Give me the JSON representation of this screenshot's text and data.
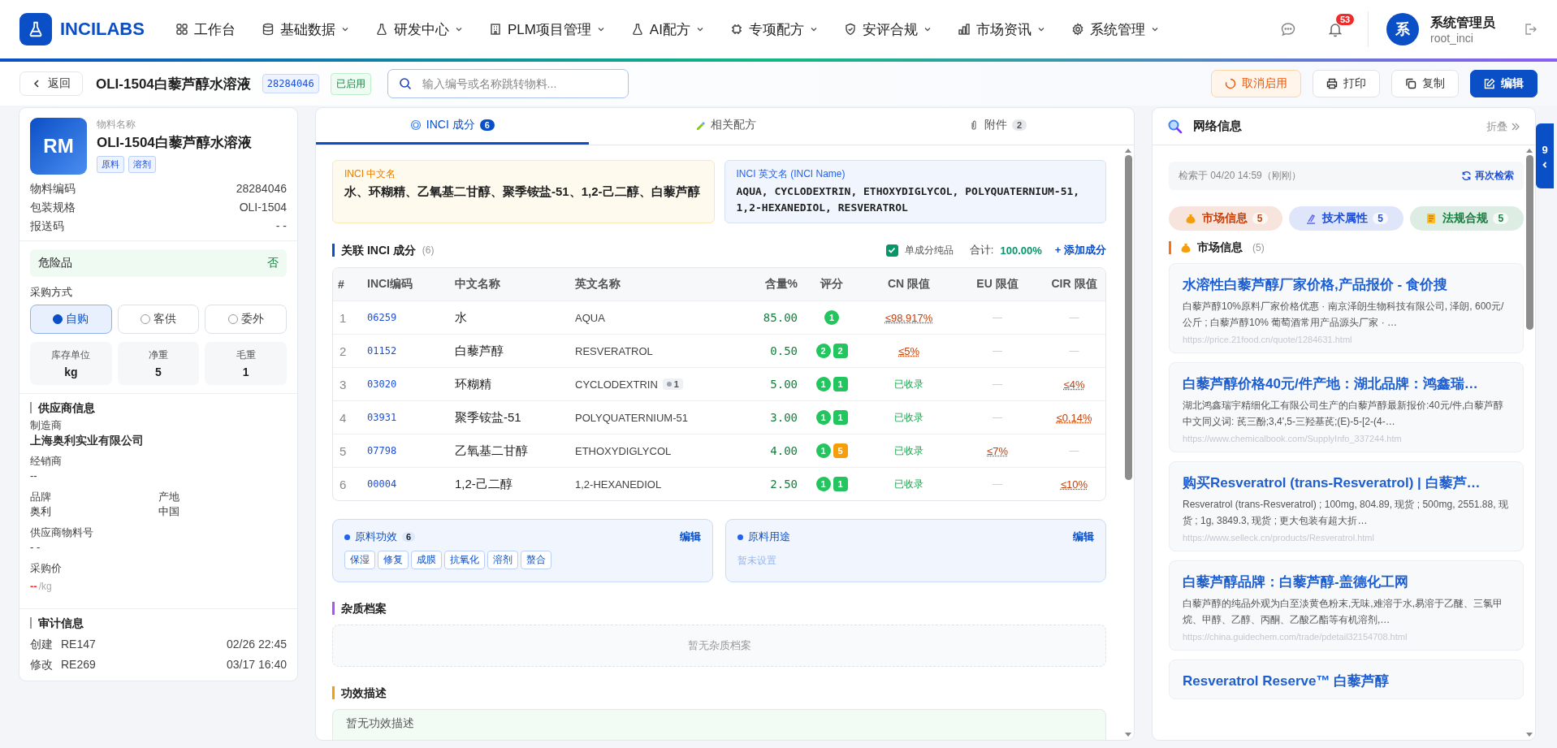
{
  "nav": {
    "logo": "INCILABS",
    "items": [
      {
        "label": "工作台",
        "dropdown": false
      },
      {
        "label": "基础数据",
        "dropdown": true
      },
      {
        "label": "研发中心",
        "dropdown": true
      },
      {
        "label": "PLM项目管理",
        "dropdown": true
      },
      {
        "label": "AI配方",
        "dropdown": true
      },
      {
        "label": "专项配方",
        "dropdown": true
      },
      {
        "label": "安评合规",
        "dropdown": true
      },
      {
        "label": "市场资讯",
        "dropdown": true
      },
      {
        "label": "系统管理",
        "dropdown": true
      }
    ],
    "notifications": "53",
    "user": {
      "avatar": "系",
      "name": "系统管理员",
      "account": "root_inci"
    }
  },
  "toolbar": {
    "back": "返回",
    "title": "OLI-1504白藜芦醇水溶液",
    "code": "28284046",
    "status": "已启用",
    "search": {
      "placeholder": "输入编号或名称跳转物料..."
    },
    "buttons": [
      {
        "label": "取消启用",
        "kind": "warning"
      },
      {
        "label": "打印",
        "kind": "default"
      },
      {
        "label": "复制",
        "kind": "default"
      },
      {
        "label": "编辑",
        "kind": "primary"
      }
    ]
  },
  "material": {
    "avatar": "RM",
    "name_label": "物料名称",
    "name": "OLI-1504白藜芦醇水溶液",
    "tags": [
      "原料",
      "溶剂"
    ],
    "fields": [
      {
        "label": "物料编码",
        "value": "28284046"
      },
      {
        "label": "包装规格",
        "value": "OLI-1504"
      },
      {
        "label": "报送码",
        "value": "- -"
      }
    ],
    "hazard": {
      "label": "危险品",
      "value": "否"
    },
    "purchase": {
      "label": "采购方式",
      "options": [
        {
          "label": "自购",
          "selected": true
        },
        {
          "label": "客供",
          "selected": false
        },
        {
          "label": "委外",
          "selected": false
        }
      ]
    },
    "stats": [
      {
        "label": "库存单位",
        "value": "kg"
      },
      {
        "label": "净重",
        "value": "5"
      },
      {
        "label": "毛重",
        "value": "1"
      }
    ],
    "supplier": {
      "title": "供应商信息",
      "manufacturer": {
        "label": "制造商",
        "value": "上海奥利实业有限公司"
      },
      "distributor": {
        "label": "经销商",
        "value": "--"
      },
      "brand": {
        "label": "品牌",
        "value": "奥利"
      },
      "origin": {
        "label": "产地",
        "value": "中国"
      },
      "supplier_code": {
        "label": "供应商物料号",
        "value": "- -"
      },
      "price": {
        "label": "采购价",
        "value": "--",
        "unit": "/kg"
      }
    },
    "audit": {
      "title": "审计信息",
      "rows": [
        {
          "action": "创建",
          "user": "RE147",
          "time": "02/26 22:45"
        },
        {
          "action": "修改",
          "user": "RE269",
          "time": "03/17 16:40"
        }
      ]
    }
  },
  "tabs": [
    {
      "label": "INCI 成分",
      "count": "6",
      "selected": true
    },
    {
      "label": "相关配方",
      "selected": false
    },
    {
      "label": "附件",
      "count": "2",
      "selected": false
    }
  ],
  "inci_names": {
    "cn": {
      "label": "INCI 中文名",
      "value": "水、环糊精、乙氧基二甘醇、聚季铵盐-51、1,2-己二醇、白藜芦醇"
    },
    "en": {
      "label": "INCI 英文名 (INCI Name)",
      "value": "AQUA, CYCLODEXTRIN, ETHOXYDIGLYCOL, POLYQUATERNIUM-51, 1,2-HEXANEDIOL, RESVERATROL"
    }
  },
  "ingredients": {
    "title": "关联 INCI 成分",
    "count": "(6)",
    "single_pure": {
      "label": "单成分纯品",
      "checked": true
    },
    "total_label": "合计:",
    "total": "100.00%",
    "add": "+ 添加成分",
    "columns": [
      "#",
      "INCI编码",
      "中文名称",
      "英文名称",
      "含量%",
      "评分",
      "CN 限值",
      "EU 限值",
      "CIR 限值"
    ],
    "rows": [
      {
        "index": "1",
        "code": "06259",
        "cn": "水",
        "en": "AQUA",
        "content": "85.00",
        "scores": [
          {
            "value": "1",
            "color": "#22c55e"
          }
        ],
        "limits": [
          {
            "kind": "limit",
            "text": "≤98.917%"
          },
          {
            "kind": "none",
            "text": "—"
          },
          {
            "kind": "none",
            "text": "—"
          }
        ]
      },
      {
        "index": "2",
        "code": "01152",
        "cn": "白藜芦醇",
        "en": "RESVERATROL",
        "content": "0.50",
        "scores": [
          {
            "value": "2",
            "color": "#22c55e"
          },
          {
            "value": "2",
            "color": "#22c55e"
          }
        ],
        "limits": [
          {
            "kind": "limit",
            "text": "≤5%"
          },
          {
            "kind": "none",
            "text": "—"
          },
          {
            "kind": "none",
            "text": "—"
          }
        ]
      },
      {
        "index": "3",
        "code": "03020",
        "cn": "环糊精",
        "en": "CYCLODEXTRIN",
        "en_tag": "1",
        "content": "5.00",
        "scores": [
          {
            "value": "1",
            "color": "#22c55e"
          },
          {
            "value": "1",
            "color": "#22c55e"
          }
        ],
        "limits": [
          {
            "kind": "listed",
            "text": "已收录"
          },
          {
            "kind": "none",
            "text": "—"
          },
          {
            "kind": "limit",
            "text": "≤4%"
          }
        ]
      },
      {
        "index": "4",
        "code": "03931",
        "cn": "聚季铵盐-51",
        "en": "POLYQUATERNIUM-51",
        "content": "3.00",
        "scores": [
          {
            "value": "1",
            "color": "#22c55e"
          },
          {
            "value": "1",
            "color": "#22c55e"
          }
        ],
        "limits": [
          {
            "kind": "listed",
            "text": "已收录"
          },
          {
            "kind": "none",
            "text": "—"
          },
          {
            "kind": "limit",
            "text": "≤0.14%"
          }
        ]
      },
      {
        "index": "5",
        "code": "07798",
        "cn": "乙氧基二甘醇",
        "en": "ETHOXYDIGLYCOL",
        "content": "4.00",
        "scores": [
          {
            "value": "1",
            "color": "#22c55e"
          },
          {
            "value": "5",
            "color": "#f59e0b"
          }
        ],
        "limits": [
          {
            "kind": "listed",
            "text": "已收录"
          },
          {
            "kind": "limit",
            "text": "≤7%"
          },
          {
            "kind": "none",
            "text": "—"
          }
        ]
      },
      {
        "index": "6",
        "code": "00004",
        "cn": "1,2-己二醇",
        "en": "1,2-HEXANEDIOL",
        "content": "2.50",
        "scores": [
          {
            "value": "1",
            "color": "#22c55e"
          },
          {
            "value": "1",
            "color": "#22c55e"
          }
        ],
        "limits": [
          {
            "kind": "listed",
            "text": "已收录"
          },
          {
            "kind": "none",
            "text": "—"
          },
          {
            "kind": "limit",
            "text": "≤10%"
          }
        ]
      }
    ]
  },
  "effects": {
    "title": "原料功效",
    "count": "6",
    "edit": "编辑",
    "tags": [
      "保湿",
      "修复",
      "成膜",
      "抗氧化",
      "溶剂",
      "螯合"
    ]
  },
  "uses": {
    "title": "原料用途",
    "edit": "编辑",
    "empty": "暂未设置"
  },
  "impurities": {
    "title": "杂质档案",
    "empty": "暂无杂质档案"
  },
  "efficacy": {
    "title": "功效描述",
    "empty": "暂无功效描述"
  },
  "web_info": {
    "title": "网络信息",
    "collapse": "折叠",
    "searched": "检索于 04/20 14:59（刚刚）",
    "research": "再次检索",
    "categories": [
      {
        "label": "市场信息",
        "count": "5",
        "color": "#c2410c"
      },
      {
        "label": "技术属性",
        "count": "5",
        "color": "#1d4ed8"
      },
      {
        "label": "法规合规",
        "count": "5",
        "color": "#15803d"
      }
    ],
    "section": {
      "title": "市场信息",
      "count": "(5)"
    },
    "results": [
      {
        "title": "水溶性白藜芦醇厂家价格,产品报价 - 食价搜",
        "snippet": "白藜芦醇10%原料厂家价格优惠 · 南京泽朗生物科技有限公司, 泽朗, 600元/公斤 ; 白藜芦醇10% 葡萄酒常用产品源头厂家 · …",
        "url": "https://price.21food.cn/quote/1284631.html"
      },
      {
        "title": "白藜芦醇价格40元/件产地：湖北品牌：鸿鑫瑞…",
        "snippet": "湖北鸿鑫瑞宇精细化工有限公司生产的白藜芦醇最新报价:40元/件,白藜芦醇中文同义词: 芪三酚;3,4',5-三羟基芪;(E)-5-[2-(4-…",
        "url": "https://www.chemicalbook.com/SupplyInfo_337244.htm"
      },
      {
        "title": "购买Resveratrol (trans-Resveratrol) | 白藜芦…",
        "snippet": "Resveratrol (trans-Resveratrol) ; 100mg, 804.89, 现货 ; 500mg, 2551.88, 现货 ; 1g, 3849.3, 现货 ; 更大包装有超大折…",
        "url": "https://www.selleck.cn/products/Resveratrol.html"
      },
      {
        "title": "白藜芦醇品牌：白藜芦醇-盖德化工网",
        "snippet": "白藜芦醇的纯品外观为白至淡黄色粉末,无味,难溶于水,易溶于乙醚、三氯甲烷、甲醇、乙醇、丙酮、乙酸乙酯等有机溶剂,…",
        "url": "https://china.guidechem.com/trade/pdetail32154708.html"
      },
      {
        "title": "Resveratrol Reserve™ 白藜芦醇"
      }
    ]
  },
  "side_tab": {
    "count": "9"
  }
}
